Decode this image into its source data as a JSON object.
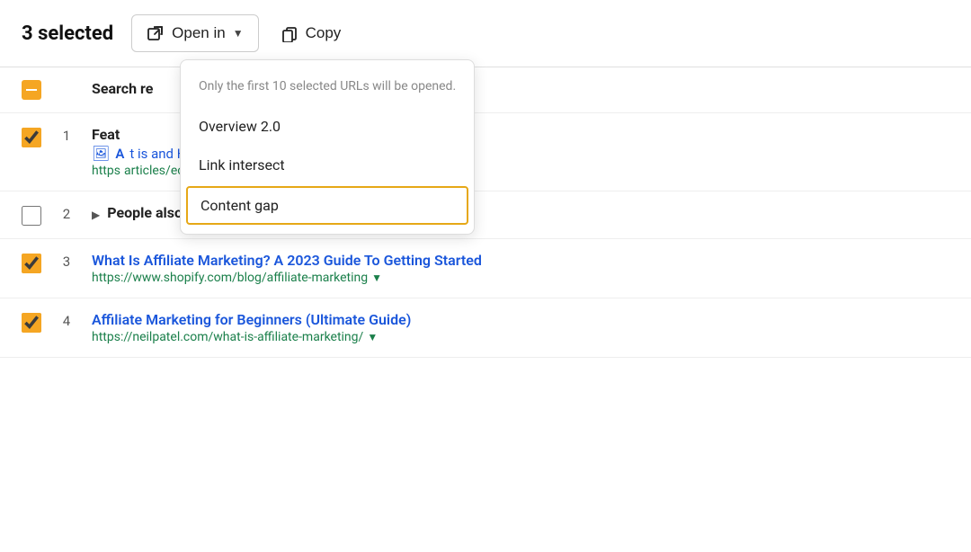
{
  "toolbar": {
    "selected_count": "3 selected",
    "open_in_label": "Open in",
    "copy_label": "Copy"
  },
  "dropdown": {
    "hint": "Only the first 10 selected URLs will be opened.",
    "items": [
      {
        "id": "overview",
        "label": "Overview 2.0",
        "highlighted": false
      },
      {
        "id": "link-intersect",
        "label": "Link intersect",
        "highlighted": false
      },
      {
        "id": "content-gap",
        "label": "Content gap",
        "highlighted": true
      }
    ]
  },
  "rows": [
    {
      "id": "header-row",
      "type": "header",
      "number": "",
      "title": "Search re",
      "is_checked": "indeterminate"
    },
    {
      "id": "row-1",
      "type": "result",
      "number": "1",
      "title": "Feat",
      "snippet_text": "A",
      "snippet_link": "t is and How to Get Started",
      "url_short": "https",
      "url_long": "articles/ecommerce/affiliate-marketing/",
      "is_checked": true
    },
    {
      "id": "row-2",
      "type": "group",
      "number": "2",
      "title": "People also ask",
      "is_checked": false
    },
    {
      "id": "row-3",
      "type": "result",
      "number": "3",
      "title_link": "What Is Affiliate Marketing? A 2023 Guide To Getting Started",
      "url": "https://www.shopify.com/blog/affiliate-marketing",
      "is_checked": true
    },
    {
      "id": "row-4",
      "type": "result",
      "number": "4",
      "title_link": "Affiliate Marketing for Beginners (Ultimate Guide)",
      "url": "https://neilpatel.com/what-is-affiliate-marketing/",
      "is_checked": true
    }
  ],
  "colors": {
    "accent": "#f5a623",
    "link": "#1a56db",
    "url_green": "#1a7f4a",
    "border": "#e0e0e0",
    "highlight_border": "#e6a817"
  }
}
